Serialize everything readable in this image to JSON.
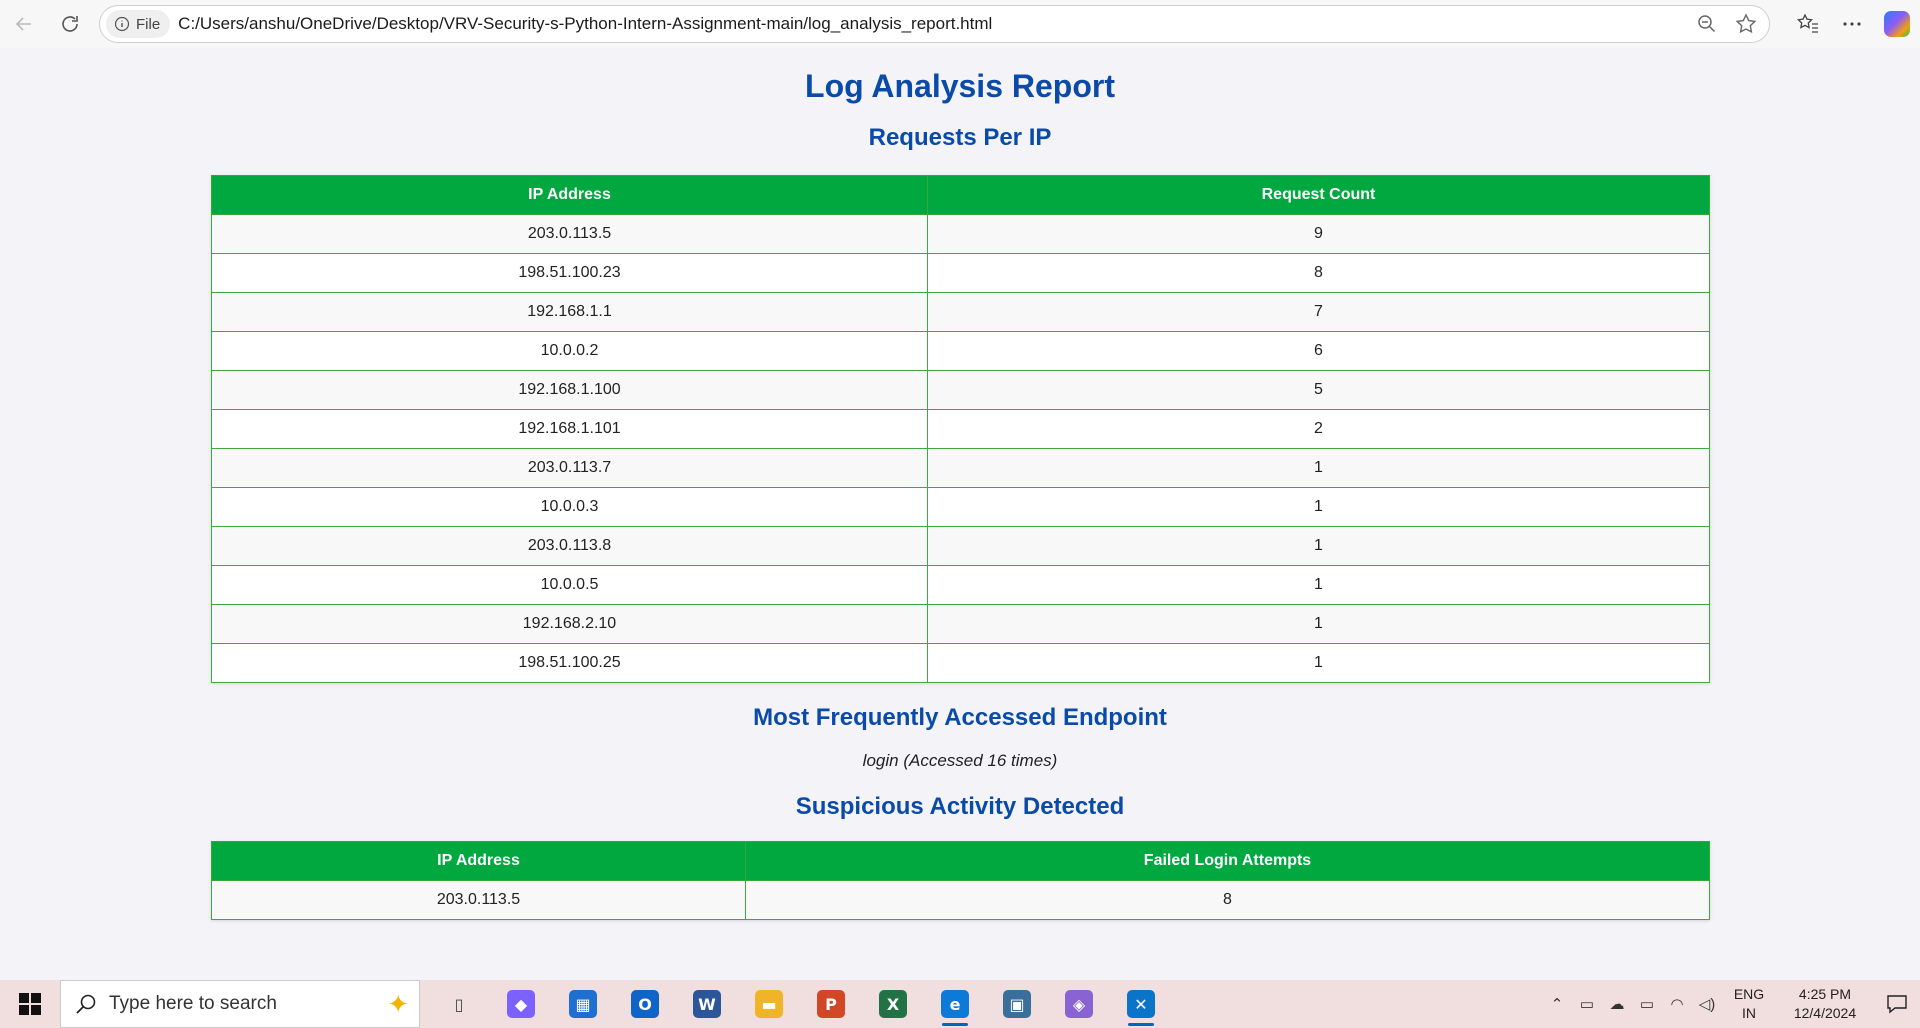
{
  "browser": {
    "file_chip": "File",
    "url": "C:/Users/anshu/OneDrive/Desktop/VRV-Security-s-Python-Intern-Assignment-main/log_analysis_report.html"
  },
  "report": {
    "title": "Log Analysis Report",
    "requests_section": {
      "title": "Requests Per IP",
      "columns": [
        "IP Address",
        "Request Count"
      ],
      "rows": [
        [
          "203.0.113.5",
          "9"
        ],
        [
          "198.51.100.23",
          "8"
        ],
        [
          "192.168.1.1",
          "7"
        ],
        [
          "10.0.0.2",
          "6"
        ],
        [
          "192.168.1.100",
          "5"
        ],
        [
          "192.168.1.101",
          "2"
        ],
        [
          "203.0.113.7",
          "1"
        ],
        [
          "10.0.0.3",
          "1"
        ],
        [
          "203.0.113.8",
          "1"
        ],
        [
          "10.0.0.5",
          "1"
        ],
        [
          "192.168.2.10",
          "1"
        ],
        [
          "198.51.100.25",
          "1"
        ]
      ]
    },
    "endpoint_section": {
      "title": "Most Frequently Accessed Endpoint",
      "text": "login (Accessed 16 times)"
    },
    "suspicious_section": {
      "title": "Suspicious Activity Detected",
      "columns": [
        "IP Address",
        "Failed Login Attempts"
      ],
      "rows": [
        [
          "203.0.113.5",
          "8"
        ]
      ]
    }
  },
  "taskbar": {
    "search_placeholder": "Type here to search",
    "apps": [
      {
        "name": "task-view",
        "glyph": "▯",
        "color": "#444444"
      },
      {
        "name": "copilot",
        "glyph": "◆",
        "color": "#7b61ff"
      },
      {
        "name": "microsoft-store",
        "glyph": "▦",
        "color": "#1f6fd1"
      },
      {
        "name": "outlook",
        "glyph": "O",
        "color": "#0f64c8"
      },
      {
        "name": "word",
        "glyph": "W",
        "color": "#2b579a"
      },
      {
        "name": "file-explorer",
        "glyph": "▬",
        "color": "#f0b429"
      },
      {
        "name": "powerpoint",
        "glyph": "P",
        "color": "#d24726"
      },
      {
        "name": "excel",
        "glyph": "X",
        "color": "#217346"
      },
      {
        "name": "edge",
        "glyph": "e",
        "color": "#0c7ad6"
      },
      {
        "name": "python-idle",
        "glyph": "▣",
        "color": "#3a6f9c"
      },
      {
        "name": "m365",
        "glyph": "◈",
        "color": "#8a63d2"
      },
      {
        "name": "vscode",
        "glyph": "✕",
        "color": "#0a74c9"
      }
    ],
    "lang_top": "ENG",
    "lang_bottom": "IN",
    "time": "4:25 PM",
    "date": "12/4/2024"
  }
}
